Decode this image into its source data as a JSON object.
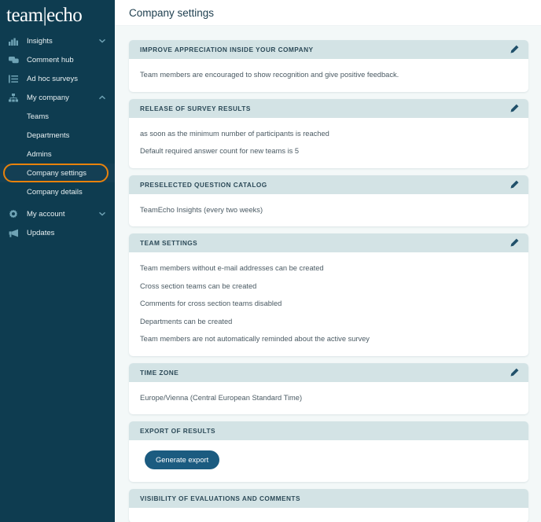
{
  "brand": {
    "name_left": "team",
    "divider": "|",
    "name_right": "echo"
  },
  "sidebar": {
    "items": [
      {
        "label": "Insights",
        "icon": "bar-chart-icon",
        "chevron": "down",
        "type": "group"
      },
      {
        "label": "Comment hub",
        "icon": "comments-icon",
        "chevron": "",
        "type": "item"
      },
      {
        "label": "Ad hoc surveys",
        "icon": "list-icon",
        "chevron": "",
        "type": "item"
      },
      {
        "label": "My company",
        "icon": "sitemap-icon",
        "chevron": "up",
        "type": "group"
      }
    ],
    "company_children": [
      {
        "label": "Teams",
        "active": false,
        "highlighted": false
      },
      {
        "label": "Departments",
        "active": false,
        "highlighted": false
      },
      {
        "label": "Admins",
        "active": false,
        "highlighted": false
      },
      {
        "label": "Company settings",
        "active": true,
        "highlighted": true
      },
      {
        "label": "Company details",
        "active": false,
        "highlighted": false
      }
    ],
    "bottom_items": [
      {
        "label": "My account",
        "icon": "gear-icon",
        "chevron": "down"
      },
      {
        "label": "Updates",
        "icon": "megaphone-icon",
        "chevron": ""
      }
    ],
    "highlight_color": "#e8820c",
    "background_color": "#0e3c50"
  },
  "header": {
    "title": "Company settings"
  },
  "main": {
    "cards": [
      {
        "title": "Improve appreciation inside your company",
        "editable": true,
        "rows": [
          "Team members are encouraged to show recognition and give positive feedback."
        ]
      },
      {
        "title": "Release of survey results",
        "editable": true,
        "rows": [
          "as soon as the minimum number of participants is reached",
          "Default required answer count for new teams is 5"
        ]
      },
      {
        "title": "Preselected question catalog",
        "editable": true,
        "rows": [
          "TeamEcho Insights (every two weeks)"
        ]
      },
      {
        "title": "Team settings",
        "editable": true,
        "rows": [
          "Team members without e-mail addresses can be created",
          "Cross section teams can be created",
          "Comments for cross section teams disabled",
          "Departments can be created",
          "Team members are not automatically reminded about the active survey"
        ]
      },
      {
        "title": "Time zone",
        "editable": true,
        "rows": [
          "Europe/Vienna (Central European Standard Time)"
        ]
      },
      {
        "title": "Export of results",
        "editable": false,
        "rows": [],
        "button": "Generate export"
      },
      {
        "title": "Visibility of evaluations and comments",
        "editable": false,
        "rows": []
      }
    ]
  },
  "colors": {
    "accent": "#1b5b80",
    "card_header": "#d3e3e5",
    "page_bg": "#f3f8f8"
  }
}
